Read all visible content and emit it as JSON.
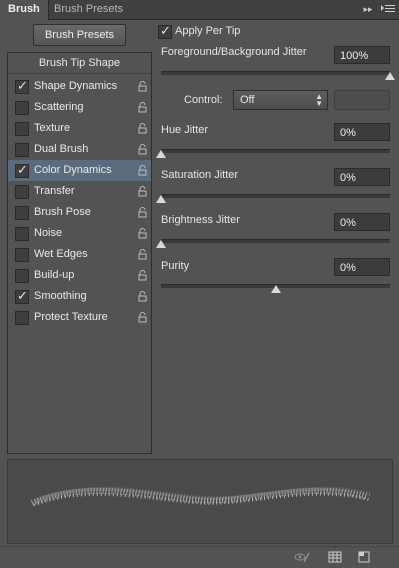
{
  "tabs": [
    {
      "label": "Brush",
      "active": true
    },
    {
      "label": "Brush Presets",
      "active": false
    }
  ],
  "brush_presets_button": "Brush Presets",
  "brush_tip_shape": "Brush Tip Shape",
  "items": [
    {
      "label": "Shape Dynamics",
      "checked": true,
      "selected": false
    },
    {
      "label": "Scattering",
      "checked": false,
      "selected": false
    },
    {
      "label": "Texture",
      "checked": false,
      "selected": false
    },
    {
      "label": "Dual Brush",
      "checked": false,
      "selected": false
    },
    {
      "label": "Color Dynamics",
      "checked": true,
      "selected": true
    },
    {
      "label": "Transfer",
      "checked": false,
      "selected": false
    },
    {
      "label": "Brush Pose",
      "checked": false,
      "selected": false
    },
    {
      "label": "Noise",
      "checked": false,
      "selected": false
    },
    {
      "label": "Wet Edges",
      "checked": false,
      "selected": false
    },
    {
      "label": "Build-up",
      "checked": false,
      "selected": false
    },
    {
      "label": "Smoothing",
      "checked": true,
      "selected": false
    },
    {
      "label": "Protect Texture",
      "checked": false,
      "selected": false
    }
  ],
  "apply_per_tip": {
    "label": "Apply Per Tip",
    "checked": true
  },
  "fg_bg_jitter": {
    "label": "Foreground/Background Jitter",
    "value": "100%",
    "level": 1.0
  },
  "control": {
    "label": "Control:",
    "value": "Off"
  },
  "hue_jitter": {
    "label": "Hue Jitter",
    "value": "0%",
    "level": 0.0
  },
  "saturation_jitter": {
    "label": "Saturation Jitter",
    "value": "0%",
    "level": 0.0
  },
  "brightness_jitter": {
    "label": "Brightness Jitter",
    "value": "0%",
    "level": 0.0
  },
  "purity": {
    "label": "Purity",
    "value": "0%",
    "level": 0.5
  },
  "icons": {
    "collapse": "double-chevron-right-icon",
    "menu": "panel-menu-icon",
    "lock": "lock-icon",
    "toggle_preview": "eye-brush-icon",
    "grid": "grid-icon",
    "new_preset": "new-preset-icon"
  },
  "colors": {
    "panel": "#535353",
    "selected_row": "#5b6b7d",
    "field": "#3c3c3c"
  }
}
